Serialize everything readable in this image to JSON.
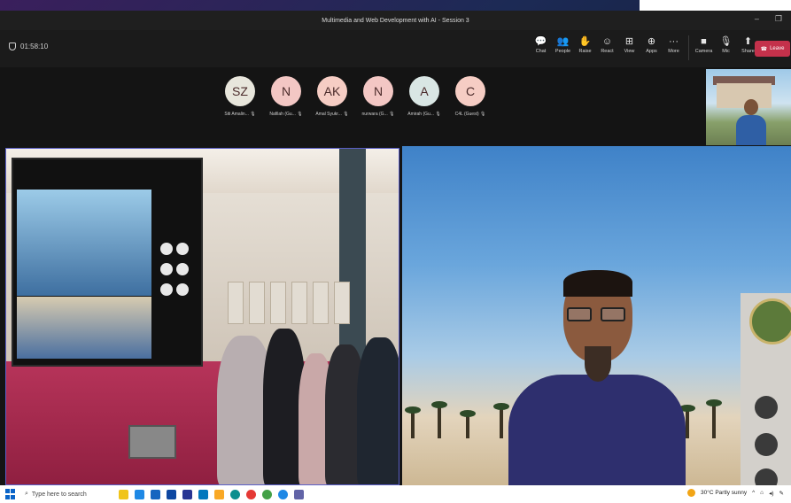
{
  "window": {
    "title": "Multimedia and Web Development with AI - Session 3",
    "controls": [
      "–",
      "❐"
    ]
  },
  "meeting": {
    "timer": "01:58:10",
    "tools": [
      {
        "label": "Chat",
        "icon": "chat-icon",
        "glyph": "💬"
      },
      {
        "label": "People",
        "icon": "people-icon",
        "glyph": "👥"
      },
      {
        "label": "Raise",
        "icon": "raise-hand-icon",
        "glyph": "✋"
      },
      {
        "label": "React",
        "icon": "react-icon",
        "glyph": "☺"
      },
      {
        "label": "View",
        "icon": "view-icon",
        "glyph": "⊞"
      },
      {
        "label": "Apps",
        "icon": "apps-icon",
        "glyph": "⊕"
      },
      {
        "label": "More",
        "icon": "more-icon",
        "glyph": "···"
      }
    ],
    "devices": [
      {
        "label": "Camera",
        "icon": "camera-icon",
        "glyph": "■"
      },
      {
        "label": "Mic",
        "icon": "mic-icon",
        "glyph": "🎙"
      },
      {
        "label": "Share",
        "icon": "share-icon",
        "glyph": "⬆"
      }
    ],
    "leave_label": "Leave"
  },
  "participants": [
    {
      "initials": "SZ",
      "name": "Siti Amalin... ",
      "color": "#e8e6dc"
    },
    {
      "initials": "N",
      "name": "Nafilah (Gu...",
      "color": "#f3c7c4"
    },
    {
      "initials": "AK",
      "name": "Amal Syukr...",
      "color": "#f6cdc4"
    },
    {
      "initials": "N",
      "name": "nurwara (G...",
      "color": "#f3c7c4"
    },
    {
      "initials": "A",
      "name": "Amirah (Gu...",
      "color": "#d9e6e4"
    },
    {
      "initials": "C",
      "name": "C4L (Guest)",
      "color": "#f6cdc4"
    }
  ],
  "taskbar": {
    "search_placeholder": "Type here to search",
    "weather": "30°C  Partly sunny"
  },
  "colors": {
    "accent": "#5b5fc7",
    "leave": "#c4314b",
    "toolbar": "#1b1b1b"
  }
}
